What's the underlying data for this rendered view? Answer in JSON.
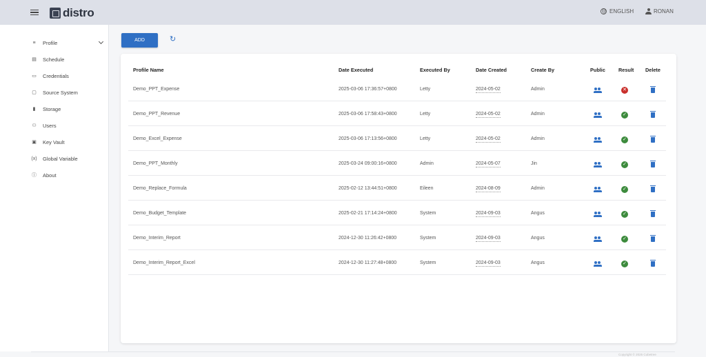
{
  "header": {
    "logo_text": "distro",
    "language": "ENGLISH",
    "user": "RONAN"
  },
  "sidebar": {
    "items": [
      {
        "label": "Profile",
        "icon": "list-icon"
      },
      {
        "label": "Schedule",
        "icon": "calendar-icon"
      },
      {
        "label": "Credentials",
        "icon": "id-card-icon"
      },
      {
        "label": "Source System",
        "icon": "monitor-icon"
      },
      {
        "label": "Storage",
        "icon": "database-icon"
      },
      {
        "label": "Users",
        "icon": "users-icon"
      },
      {
        "label": "Key Vault",
        "icon": "key-vault-icon"
      },
      {
        "label": "Global Variable",
        "icon": "variable-icon"
      },
      {
        "label": "About",
        "icon": "info-icon"
      }
    ]
  },
  "toolbar": {
    "add_label": "ADD"
  },
  "table": {
    "columns": [
      "Profile Name",
      "Date Executed",
      "Executed By",
      "Date Created",
      "Create By",
      "Public",
      "Result",
      "Delete"
    ],
    "rows": [
      {
        "name": "Demo_PPT_Expense",
        "executed": "2025-03-06 17:36:57+0800",
        "executed_by": "Letty",
        "created": "2024-05-02",
        "create_by": "Admin",
        "result": "fail"
      },
      {
        "name": "Demo_PPT_Revenue",
        "executed": "2025-03-06 17:58:43+0800",
        "executed_by": "Letty",
        "created": "2024-05-02",
        "create_by": "Admin",
        "result": "ok"
      },
      {
        "name": "Demo_Excel_Expense",
        "executed": "2025-03-06 17:13:56+0800",
        "executed_by": "Letty",
        "created": "2024-05-02",
        "create_by": "Admin",
        "result": "ok"
      },
      {
        "name": "Demo_PPT_Monthly",
        "executed": "2025-03-24 09:00:16+0800",
        "executed_by": "Admin",
        "created": "2024-05-07",
        "create_by": "Jin",
        "result": "ok"
      },
      {
        "name": "Demo_Replace_Formula",
        "executed": "2025-02-12 13:44:51+0800",
        "executed_by": "Eileen",
        "created": "2024-08-09",
        "create_by": "Admin",
        "result": "ok"
      },
      {
        "name": "Demo_Budget_Template",
        "executed": "2025-02-21 17:14:24+0800",
        "executed_by": "System",
        "created": "2024-09-03",
        "create_by": "Angus",
        "result": "ok"
      },
      {
        "name": "Demo_Interim_Report",
        "executed": "2024-12-30 11:26:42+0800",
        "executed_by": "System",
        "created": "2024-09-03",
        "create_by": "Angus",
        "result": "ok"
      },
      {
        "name": "Demo_Interim_Report_Excel",
        "executed": "2024-12-30 11:27:48+0800",
        "executed_by": "System",
        "created": "2024-09-03",
        "create_by": "Angus",
        "result": "ok"
      }
    ]
  },
  "footer": {
    "copyright": "Copyright © 2025 Cubetree"
  },
  "colors": {
    "accent": "#2f6fc4",
    "success": "#3d8b3d",
    "error": "#c9302c"
  }
}
